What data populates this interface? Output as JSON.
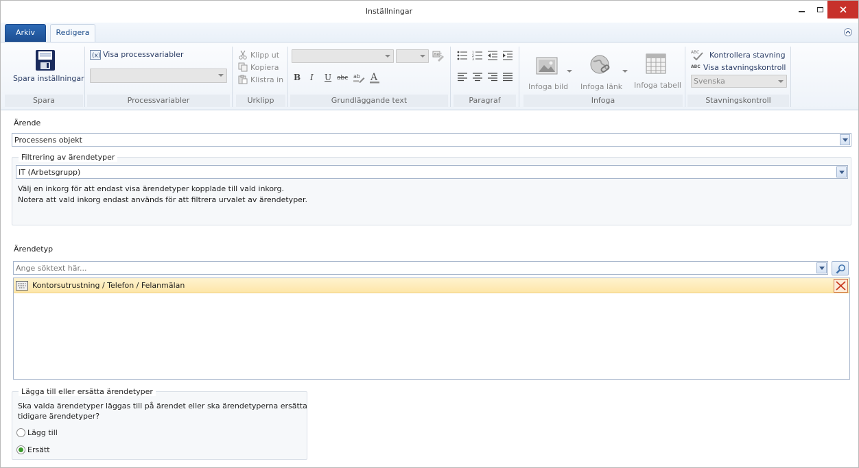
{
  "window": {
    "title": "Inställningar"
  },
  "tabs": {
    "arkiv": "Arkiv",
    "redigera": "Redigera"
  },
  "ribbon": {
    "spara": {
      "button": "Spara inställningar",
      "group": "Spara"
    },
    "processvariabler": {
      "toggle": "Visa processvariabler",
      "group": "Processvariabler"
    },
    "urklipp": {
      "cut": "Klipp ut",
      "copy": "Kopiera",
      "paste": "Klistra in",
      "group": "Urklipp"
    },
    "text": {
      "group": "Grundläggande text"
    },
    "paragraf": {
      "group": "Paragraf"
    },
    "infoga": {
      "image": "Infoga bild",
      "link": "Infoga länk",
      "table": "Infoga tabell",
      "group": "Infoga"
    },
    "stavning": {
      "check": "Kontrollera stavning",
      "show": "Visa stavningskontroll",
      "language": "Svenska",
      "group": "Stavningskontroll"
    }
  },
  "arende": {
    "label": "Ärende",
    "value": "Processens objekt"
  },
  "filtrering": {
    "legend": "Filtrering av ärendetyper",
    "value": "IT (Arbetsgrupp)",
    "info_line1": "Välj en inkorg för att endast visa ärendetyper kopplade till vald inkorg.",
    "info_line2": "Notera att vald inkorg endast används för att filtrera urvalet av ärendetyper."
  },
  "arendetyp": {
    "label": "Ärendetyp",
    "search_placeholder": "Ange söktext här...",
    "items": [
      {
        "text": "Kontorsutrustning / Telefon / Felanmälan"
      }
    ]
  },
  "lagga": {
    "legend": "Lägga till eller ersätta ärendetyper",
    "question_line1": "Ska valda ärendetyper läggas till på ärendet eller ska ärendetyperna ersätta",
    "question_line2": "tidigare ärendetyper?",
    "option_add": "Lägg till",
    "option_replace": "Ersätt",
    "selected": "Ersätt"
  }
}
